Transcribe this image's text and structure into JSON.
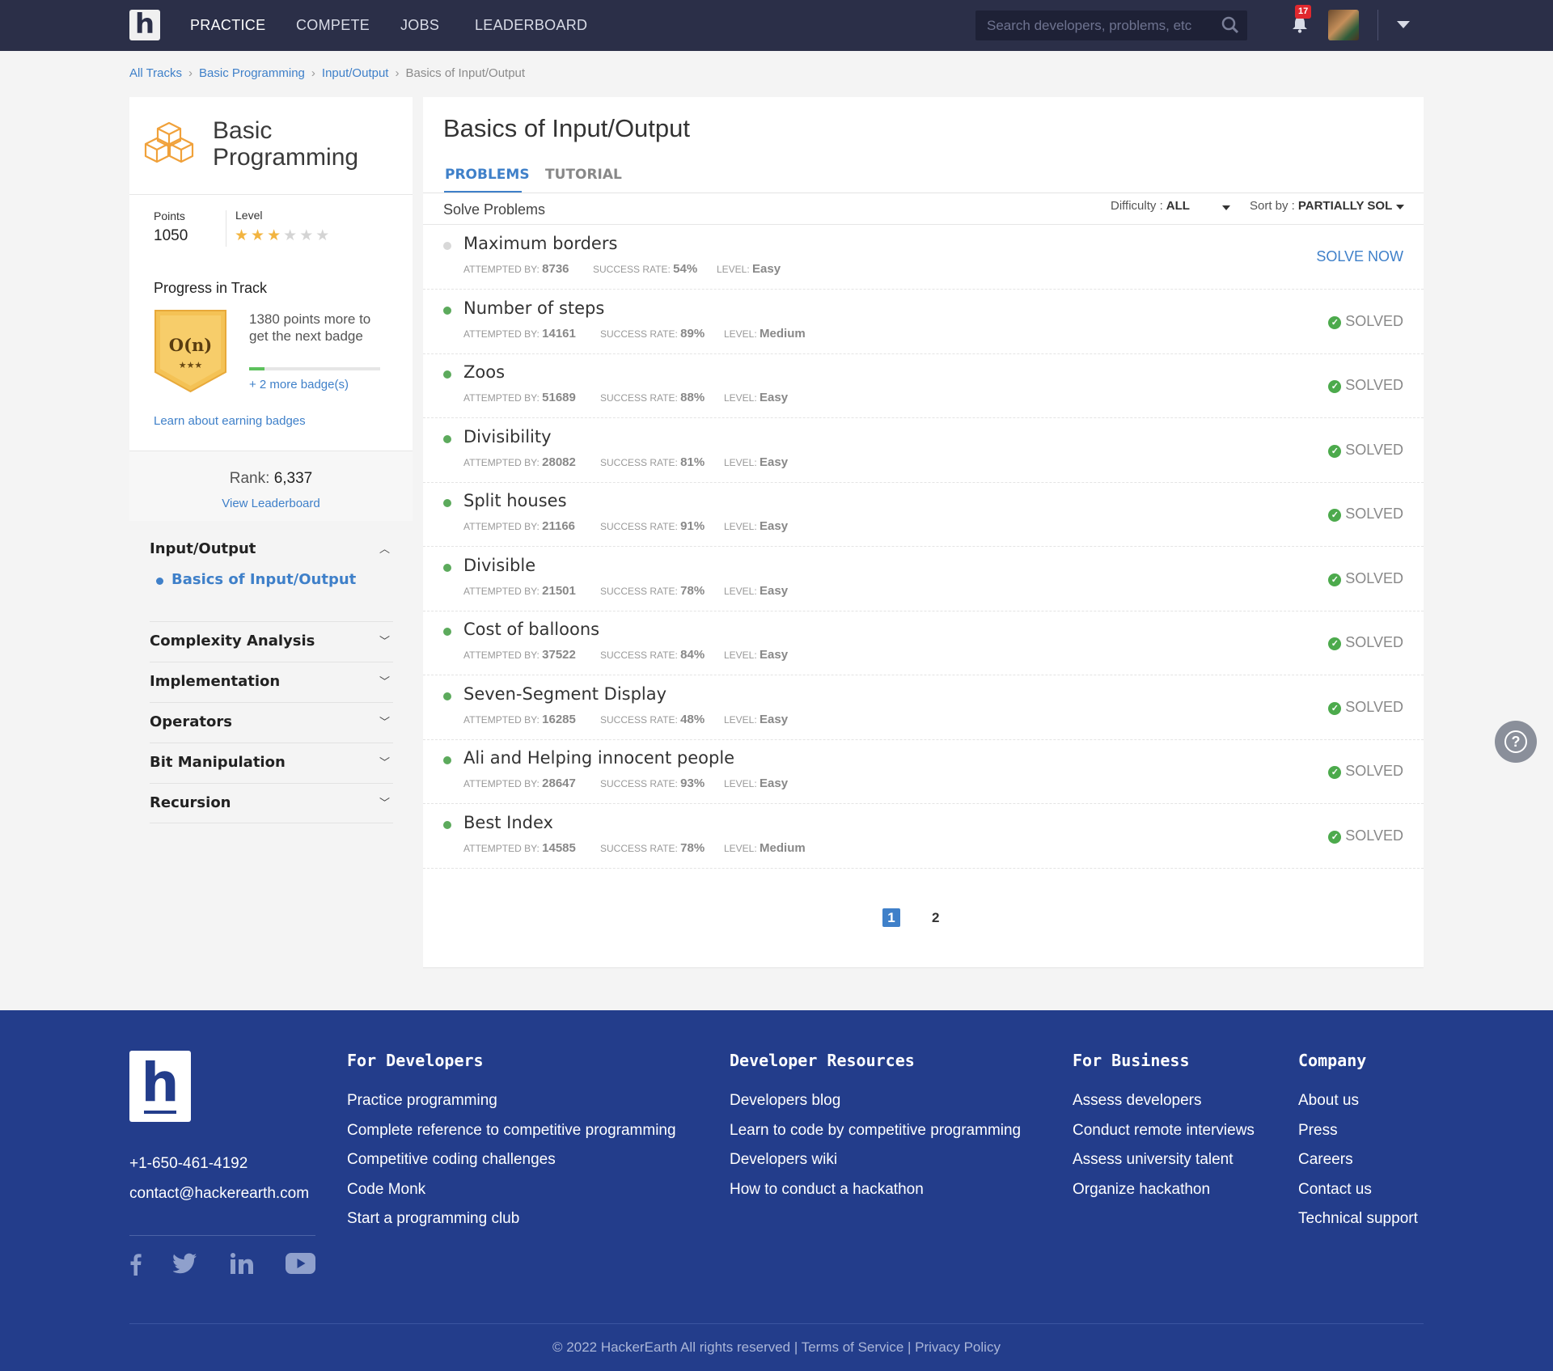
{
  "nav": {
    "items": [
      "PRACTICE",
      "COMPETE",
      "JOBS",
      "LEADERBOARD"
    ],
    "active": "PRACTICE",
    "search_placeholder": "Search developers, problems, etc",
    "notification_count": "17"
  },
  "breadcrumb": [
    "All Tracks",
    "Basic Programming",
    "Input/Output",
    "Basics of Input/Output"
  ],
  "track": {
    "title": "Basic Programming",
    "points_label": "Points",
    "points": "1050",
    "level_label": "Level",
    "level_stars": 3,
    "level_max": 6,
    "progress_title": "Progress in Track",
    "badge_text": "O(n)",
    "next_badge_text": "1380 points more to get the next badge",
    "badge_progress": 0.12,
    "more_badges": "+ 2 more badge(s)",
    "learn_link": "Learn about earning badges",
    "rank_label": "Rank:",
    "rank": "6,337",
    "leaderboard_link": "View Leaderboard"
  },
  "topics": {
    "current": "Input/Output",
    "current_sub": "Basics of Input/Output",
    "others": [
      "Complexity Analysis",
      "Implementation",
      "Operators",
      "Bit Manipulation",
      "Recursion"
    ]
  },
  "main": {
    "title": "Basics of Input/Output",
    "tabs": [
      "PROBLEMS",
      "TUTORIAL"
    ],
    "section_title": "Solve Problems",
    "difficulty_label": "Difficulty :",
    "difficulty_value": "ALL",
    "sort_label": "Sort by :",
    "sort_value": "PARTIALLY SOL",
    "meta_labels": {
      "attempted": "ATTEMPTED BY:",
      "success": "SUCCESS RATE:",
      "level": "LEVEL:"
    },
    "problems": [
      {
        "name": "Maximum borders",
        "attempted": "8736",
        "success": "54%",
        "level": "Easy",
        "status": "SOLVE NOW"
      },
      {
        "name": "Number of steps",
        "attempted": "14161",
        "success": "89%",
        "level": "Medium",
        "status": "SOLVED"
      },
      {
        "name": "Zoos",
        "attempted": "51689",
        "success": "88%",
        "level": "Easy",
        "status": "SOLVED"
      },
      {
        "name": "Divisibility",
        "attempted": "28082",
        "success": "81%",
        "level": "Easy",
        "status": "SOLVED"
      },
      {
        "name": "Split houses",
        "attempted": "21166",
        "success": "91%",
        "level": "Easy",
        "status": "SOLVED"
      },
      {
        "name": "Divisible",
        "attempted": "21501",
        "success": "78%",
        "level": "Easy",
        "status": "SOLVED"
      },
      {
        "name": "Cost of balloons",
        "attempted": "37522",
        "success": "84%",
        "level": "Easy",
        "status": "SOLVED"
      },
      {
        "name": "Seven-Segment Display",
        "attempted": "16285",
        "success": "48%",
        "level": "Easy",
        "status": "SOLVED"
      },
      {
        "name": "Ali and Helping innocent people",
        "attempted": "28647",
        "success": "93%",
        "level": "Easy",
        "status": "SOLVED"
      },
      {
        "name": "Best Index",
        "attempted": "14585",
        "success": "78%",
        "level": "Medium",
        "status": "SOLVED"
      }
    ],
    "pages": [
      "1",
      "2"
    ]
  },
  "footer": {
    "phone": "+1-650-461-4192",
    "email": "contact@hackerearth.com",
    "columns": [
      {
        "title": "For Developers",
        "links": [
          "Practice programming",
          "Complete reference to competitive programming",
          "Competitive coding challenges",
          "Code Monk",
          "Start a programming club"
        ]
      },
      {
        "title": "Developer Resources",
        "links": [
          "Developers blog",
          "Learn to code by competitive programming",
          "Developers wiki",
          "How to conduct a hackathon"
        ]
      },
      {
        "title": "For Business",
        "links": [
          "Assess developers",
          "Conduct remote interviews",
          "Assess university talent",
          "Organize hackathon"
        ]
      },
      {
        "title": "Company",
        "links": [
          "About us",
          "Press",
          "Careers",
          "Contact us",
          "Technical support"
        ]
      }
    ],
    "copyright": "© 2022 HackerEarth All rights reserved | Terms of Service | Privacy Policy"
  }
}
